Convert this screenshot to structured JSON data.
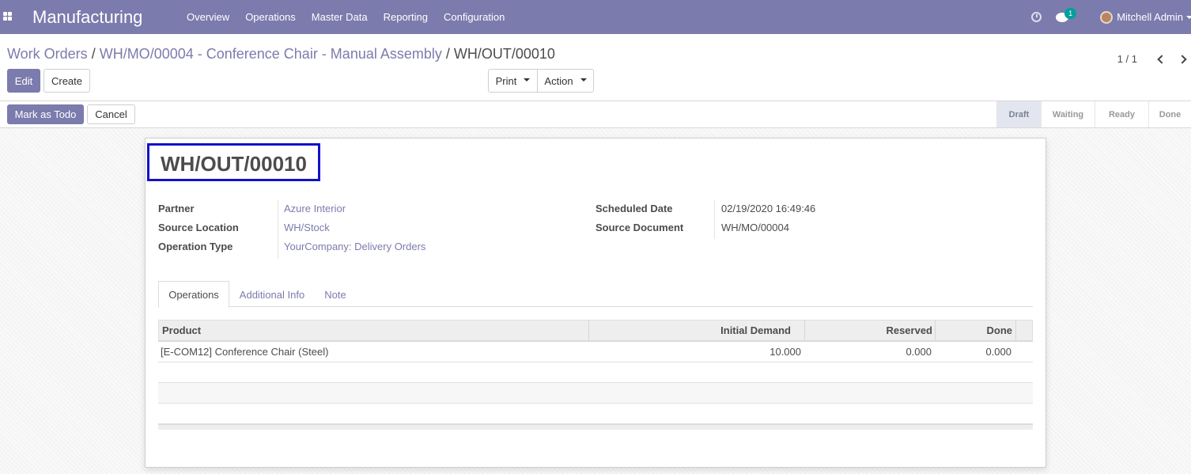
{
  "navbar": {
    "app_name": "Manufacturing",
    "menu": [
      "Overview",
      "Operations",
      "Master Data",
      "Reporting",
      "Configuration"
    ],
    "chat_badge_count": "1",
    "user_name": "Mitchell Admin",
    "accent_color": "#7c7bad"
  },
  "breadcrumb": {
    "items": [
      "Work Orders",
      "WH/MO/00004 - Conference Chair - Manual Assembly"
    ],
    "current": "WH/OUT/00010"
  },
  "control": {
    "edit_label": "Edit",
    "create_label": "Create",
    "print_label": "Print",
    "action_label": "Action",
    "pager": "1 / 1"
  },
  "statusbar": {
    "mark_todo_label": "Mark as Todo",
    "cancel_label": "Cancel",
    "stages": [
      "Draft",
      "Waiting",
      "Ready",
      "Done"
    ],
    "active_stage": "Draft"
  },
  "record": {
    "title": "WH/OUT/00010",
    "left_fields": [
      {
        "label": "Partner",
        "value": "Azure Interior"
      },
      {
        "label": "Source Location",
        "value": "WH/Stock"
      },
      {
        "label": "Operation Type",
        "value": "YourCompany: Delivery Orders"
      }
    ],
    "right_fields": [
      {
        "label": "Scheduled Date",
        "value": "02/19/2020 16:49:46"
      },
      {
        "label": "Source Document",
        "value": "WH/MO/00004"
      }
    ]
  },
  "tabs": [
    "Operations",
    "Additional Info",
    "Note"
  ],
  "table": {
    "headers": [
      "Product",
      "Initial Demand",
      "Reserved",
      "Done"
    ],
    "rows": [
      [
        "[E-COM12] Conference Chair (Steel)",
        "10.000",
        "0.000",
        "0.000"
      ]
    ]
  },
  "icons": {
    "apps": "apps-grid-icon",
    "activity": "clock-icon",
    "messaging": "chat-icon",
    "prev": "chevron-left-icon",
    "next": "chevron-right-icon"
  }
}
